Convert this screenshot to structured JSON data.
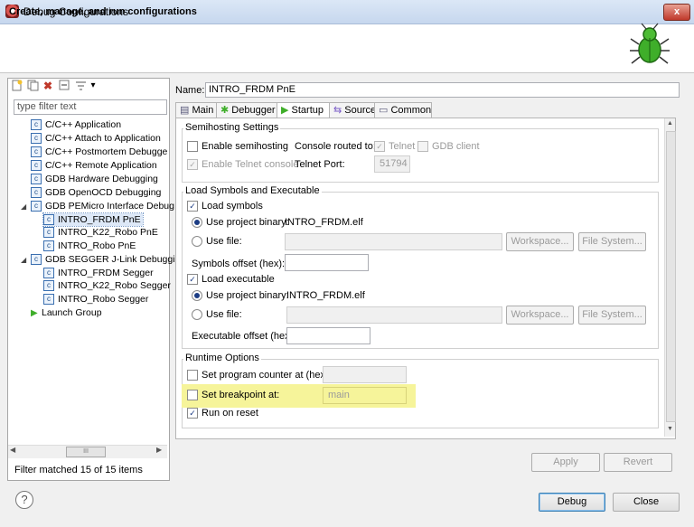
{
  "window": {
    "title": "Debug Configurations",
    "close_label": "x"
  },
  "header": {
    "title": "Create, manage, and run configurations"
  },
  "toolbar": {
    "icons": [
      "new-config-icon",
      "duplicate-icon",
      "delete-icon",
      "collapse-all-icon",
      "filter-icon"
    ],
    "delete_glyph": "✖",
    "menu_glyph": "▾"
  },
  "filter": {
    "placeholder": "type filter text",
    "status": "Filter matched 15 of 15 items"
  },
  "tree": {
    "items": [
      {
        "label": "C/C++ Application",
        "level": 1
      },
      {
        "label": "C/C++ Attach to Application",
        "level": 1
      },
      {
        "label": "C/C++ Postmortem Debugge",
        "level": 1
      },
      {
        "label": "C/C++ Remote Application",
        "level": 1
      },
      {
        "label": "GDB Hardware Debugging",
        "level": 1
      },
      {
        "label": "GDB OpenOCD Debugging",
        "level": 1
      },
      {
        "label": "GDB PEMicro Interface Debug",
        "level": 1,
        "expanded": true
      },
      {
        "label": "INTRO_FRDM PnE",
        "level": 2,
        "selected": true
      },
      {
        "label": "INTRO_K22_Robo PnE",
        "level": 2
      },
      {
        "label": "INTRO_Robo PnE",
        "level": 2
      },
      {
        "label": "GDB SEGGER J-Link Debuggin",
        "level": 1,
        "expanded": true
      },
      {
        "label": "INTRO_FRDM Segger",
        "level": 2
      },
      {
        "label": "INTRO_K22_Robo Segger",
        "level": 2
      },
      {
        "label": "INTRO_Robo Segger",
        "level": 2
      },
      {
        "label": "Launch Group",
        "level": 1,
        "icon": "launch-group-icon"
      }
    ],
    "scroll_thumb": "III"
  },
  "name": {
    "label": "Name:",
    "value": "INTRO_FRDM PnE"
  },
  "tabs": [
    {
      "label": "Main",
      "icon": "main-tab-icon"
    },
    {
      "label": "Debugger",
      "icon": "debugger-tab-icon"
    },
    {
      "label": "Startup",
      "icon": "startup-tab-icon",
      "selected": true
    },
    {
      "label": "Source",
      "icon": "source-tab-icon"
    },
    {
      "label": "Common",
      "icon": "common-tab-icon"
    }
  ],
  "semihosting": {
    "title": "Semihosting Settings",
    "enable": "Enable semihosting",
    "console_label": "Console routed to:",
    "telnet": "Telnet",
    "gdb_client": "GDB client",
    "enable_telnet": "Enable Telnet console",
    "telnet_port_label": "Telnet Port:",
    "telnet_port": "51794"
  },
  "load": {
    "title": "Load Symbols and Executable",
    "load_symbols": "Load symbols",
    "use_project_binary": "Use project binary:",
    "symbols_binary": "INTRO_FRDM.elf",
    "use_file": "Use file:",
    "workspace": "Workspace...",
    "file_system": "File System...",
    "symbols_offset": "Symbols offset (hex):",
    "load_executable": "Load executable",
    "exec_binary": "INTRO_FRDM.elf",
    "exec_offset": "Executable offset (hex):"
  },
  "runtime": {
    "title": "Runtime Options",
    "set_pc": "Set program counter at (hex):",
    "set_breakpoint": "Set breakpoint at:",
    "breakpoint_value": "main",
    "run_on_reset": "Run on reset"
  },
  "buttons": {
    "apply": "Apply",
    "revert": "Revert",
    "debug": "Debug",
    "close": "Close"
  },
  "help": "?",
  "check_glyph": "✓",
  "highlight_color": "#f6f49a"
}
